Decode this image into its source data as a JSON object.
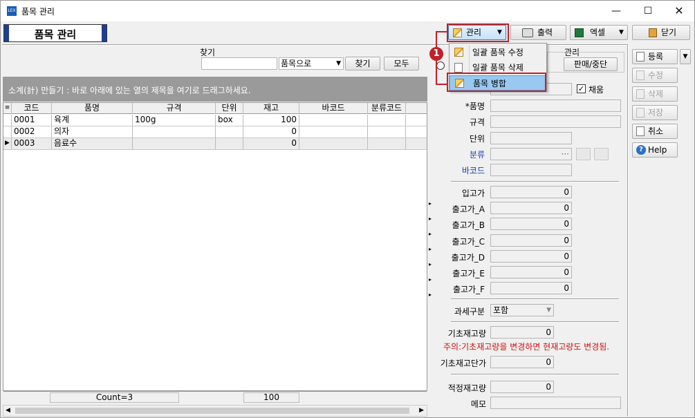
{
  "window": {
    "title": "품목 관리",
    "app_icon_text": "LEX"
  },
  "toolbar": {
    "section_title": "품목 관리",
    "manage": "관리",
    "print": "출력",
    "excel": "엑셀",
    "close": "닫기"
  },
  "manage_menu": {
    "items": [
      "일괄 품목 수정",
      "일괄 품목 삭제",
      "품목 병합"
    ],
    "step_badge": "1"
  },
  "search": {
    "label": "찾기",
    "input_value": "",
    "mode_selected": "품목으로",
    "find": "찾기",
    "all": "모두"
  },
  "manage_group": {
    "label": "관리",
    "sell_stop": "판매/중단"
  },
  "group_hint": "소계(計) 만들기 : 바로 아래에 있는 열의 제목을 여기로 드래그하세요.",
  "grid": {
    "columns": [
      "코드",
      "품명",
      "규격",
      "단위",
      "재고",
      "바코드",
      "분류코드"
    ],
    "rows": [
      [
        "0001",
        "육계",
        "100g",
        "box",
        "100",
        "",
        ""
      ],
      [
        "0002",
        "의자",
        "",
        "",
        "0",
        "",
        ""
      ],
      [
        "0003",
        "음료수",
        "",
        "",
        "0",
        "",
        ""
      ]
    ],
    "footer_count": "Count=3",
    "footer_sum": "100"
  },
  "form": {
    "numbering_label": "채움",
    "name_label": "*품명",
    "spec_label": "규격",
    "unit_label": "단위",
    "category_label": "분류",
    "category_dots": "···",
    "barcode_label": "바코드",
    "in_price_label": "입고가",
    "in_price": "0",
    "out_prices": [
      {
        "label": "출고가_A",
        "value": "0"
      },
      {
        "label": "출고가_B",
        "value": "0"
      },
      {
        "label": "출고가_C",
        "value": "0"
      },
      {
        "label": "출고가_D",
        "value": "0"
      },
      {
        "label": "출고가_E",
        "value": "0"
      },
      {
        "label": "출고가_F",
        "value": "0"
      }
    ],
    "tax_label": "과세구분",
    "tax_value": "포함",
    "init_stock_label": "기초재고량",
    "init_stock": "0",
    "warning": "주의:기초재고량을 변경하면 현재고량도 변경됨.",
    "init_cost_label": "기초재고단가",
    "init_cost": "0",
    "proper_stock_label": "적정재고량",
    "proper_stock": "0",
    "memo_label": "메모"
  },
  "side_buttons": {
    "register": "등록",
    "edit": "수정",
    "delete": "삭제",
    "save": "저장",
    "cancel": "취소",
    "help": "Help"
  },
  "colors": {
    "accent_red": "#c0202a",
    "highlight": "#99c9f0",
    "header_gray": "#9a9a9a"
  }
}
